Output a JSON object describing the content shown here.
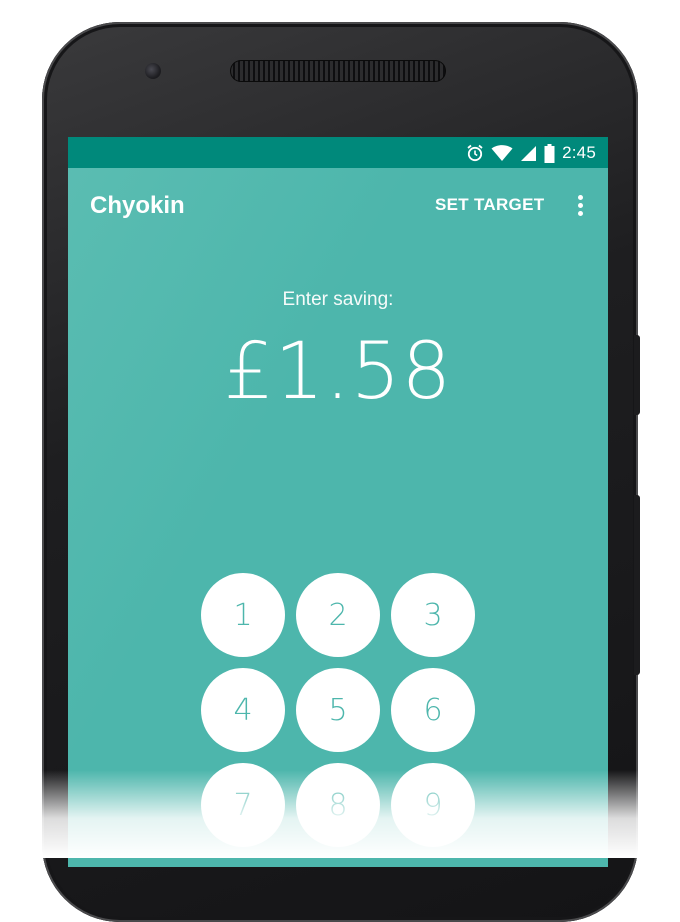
{
  "status_bar": {
    "time": "2:45",
    "icons": [
      "alarm-icon",
      "wifi-icon",
      "cell-signal-icon",
      "battery-icon"
    ]
  },
  "app_bar": {
    "title": "Chyokin",
    "action_label": "SET TARGET",
    "overflow_icon": "more-vert-icon"
  },
  "saving": {
    "prompt": "Enter saving:",
    "amount": "£1.58"
  },
  "keypad": {
    "keys": [
      "1",
      "2",
      "3",
      "4",
      "5",
      "6",
      "7",
      "8",
      "9"
    ]
  },
  "colors": {
    "primary": "#4db6ac",
    "primary_dark": "#00897b",
    "key_background": "#ffffff",
    "key_text": "#4db6ac"
  }
}
